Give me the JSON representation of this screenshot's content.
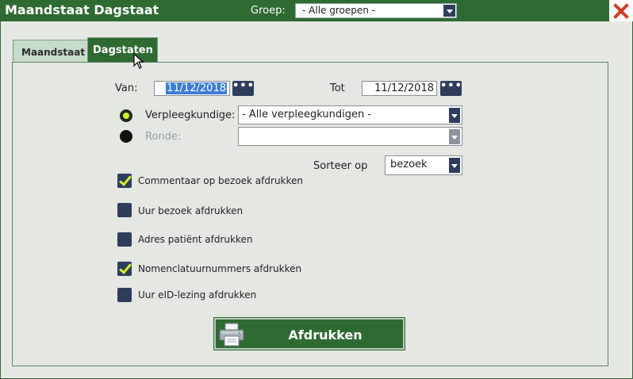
{
  "window": {
    "title": "Maandstaat Dagstaat",
    "groep_label": "Groep:",
    "groep_value": "- Alle groepen -"
  },
  "tabs": [
    {
      "label": "Maandstaat",
      "active": false
    },
    {
      "label": "Dagstaten",
      "active": true
    }
  ],
  "form": {
    "van_label": "Van:",
    "van_value": "11/12/2018",
    "tot_label": "Tot",
    "tot_value": "11/12/2018",
    "dots_label": "•••",
    "verpleegkundige_label": "Verpleegkundige:",
    "verpleegkundige_value": "- Alle verpleegkundigen -",
    "ronde_label": "Ronde:",
    "ronde_value": "",
    "sorteer_label": "Sorteer op",
    "sorteer_value": "bezoek"
  },
  "options": [
    {
      "label": "Commentaar op bezoek afdrukken",
      "checked": true
    },
    {
      "label": "Uur bezoek afdrukken",
      "checked": false
    },
    {
      "label": "Adres patiënt afdrukken",
      "checked": false
    },
    {
      "label": "Nomenclatuurnummers afdrukken",
      "checked": true
    },
    {
      "label": "Uur eID-lezing afdrukken",
      "checked": false
    }
  ],
  "print_button": {
    "label": "Afdrukken"
  },
  "colors": {
    "primary_green": "#2e6a32",
    "navy": "#2f3d5c",
    "check_lime": "#d4ee2c",
    "close_red": "#d83a2a"
  }
}
